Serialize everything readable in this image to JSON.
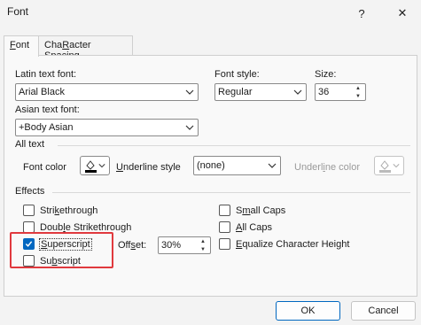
{
  "window": {
    "title": "Font",
    "help_label": "?",
    "close_label": "✕"
  },
  "tabs": [
    {
      "label": "Font",
      "underline_char": "F",
      "rest": "ont"
    },
    {
      "label": "Character Spacing",
      "underline_char": "R",
      "pre": "Cha",
      "rest": "acter Spacing"
    }
  ],
  "latin_font": {
    "label": "Latin text font:",
    "value": "Arial Black"
  },
  "font_style": {
    "label": "Font style:",
    "value": "Regular"
  },
  "size": {
    "label": "Size:",
    "value": "36"
  },
  "asian_font": {
    "label": "Asian text font:",
    "value": "+Body Asian"
  },
  "all_text": {
    "section_label": "All text",
    "font_color_label": "Font color",
    "underline_style_label": "Underline style",
    "underline_style_value": "(none)",
    "underline_color_label": "Underline color"
  },
  "effects": {
    "section_label": "Effects",
    "strikethrough": {
      "label": "Strikethrough",
      "checked": false
    },
    "double_strikethrough": {
      "label": "Double Strikethrough",
      "checked": false
    },
    "superscript": {
      "label": "Superscript",
      "checked": true
    },
    "subscript": {
      "label": "Subscript",
      "checked": false
    },
    "offset_label": "Offset:",
    "offset_value": "30%",
    "small_caps": {
      "label": "Small Caps",
      "checked": false
    },
    "all_caps": {
      "label": "All Caps",
      "checked": false
    },
    "equalize_height": {
      "label": "Equalize Character Height",
      "checked": false
    }
  },
  "buttons": {
    "ok": "OK",
    "cancel": "Cancel"
  },
  "colors": {
    "accent": "#0067c0",
    "highlight": "#e0393e"
  }
}
